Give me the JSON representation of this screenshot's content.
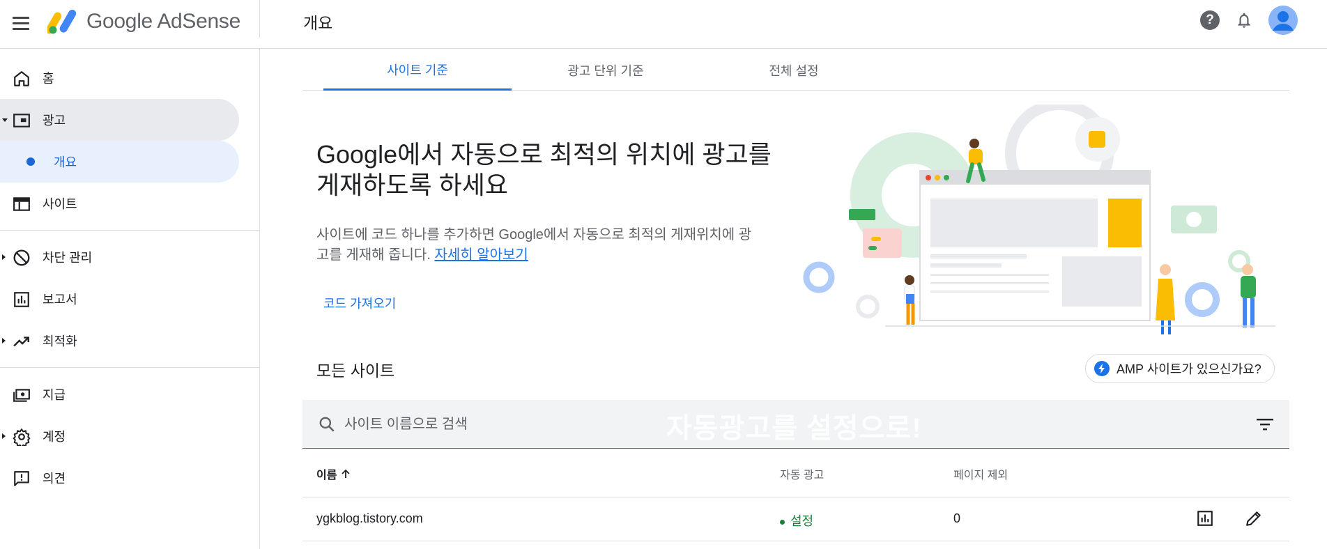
{
  "app": {
    "name": "Google AdSense",
    "page_title": "개요"
  },
  "sidebar": {
    "items": [
      {
        "label": "홈",
        "icon": "home-icon"
      },
      {
        "label": "광고",
        "icon": "ads-icon"
      },
      {
        "label": "개요",
        "icon": "dot"
      },
      {
        "label": "사이트",
        "icon": "sites-icon"
      },
      {
        "label": "차단 관리",
        "icon": "block-icon"
      },
      {
        "label": "보고서",
        "icon": "report-icon"
      },
      {
        "label": "최적화",
        "icon": "trending-icon"
      },
      {
        "label": "지급",
        "icon": "payment-icon"
      },
      {
        "label": "계정",
        "icon": "gear-icon"
      },
      {
        "label": "의견",
        "icon": "feedback-icon"
      }
    ]
  },
  "tabs": [
    {
      "label": "사이트 기준",
      "active": true
    },
    {
      "label": "광고 단위 기준",
      "active": false
    },
    {
      "label": "전체 설정",
      "active": false
    }
  ],
  "hero": {
    "title_line1": "Google에서 자동으로 최적의 위치에 광고를",
    "title_line2": "게재하도록 하세요",
    "desc_line1": "사이트에 코드 하나를 추가하면 Google에서 자동으로 최적의 게재위치에 광",
    "desc_line2": "고를 게재해 줍니다.",
    "learn_more": "자세히 알아보기",
    "cta": "코드 가져오기"
  },
  "sites": {
    "title": "모든 사이트",
    "amp_button": "AMP 사이트가 있으신가요?",
    "search_placeholder": "사이트 이름으로 검색",
    "overlay": "자동광고를 설정으로!",
    "columns": {
      "name": "이름",
      "auto_ads": "자동 광고",
      "excluded_pages": "페이지 제외"
    },
    "rows": [
      {
        "name": "ygkblog.tistory.com",
        "auto_ads": "설정",
        "excluded_pages": "0"
      }
    ]
  },
  "colors": {
    "accent": "#1a73e8",
    "status_on": "#188038",
    "logo_yellow": "#fbbc04",
    "logo_green": "#34a853",
    "logo_blue": "#4285f4"
  }
}
